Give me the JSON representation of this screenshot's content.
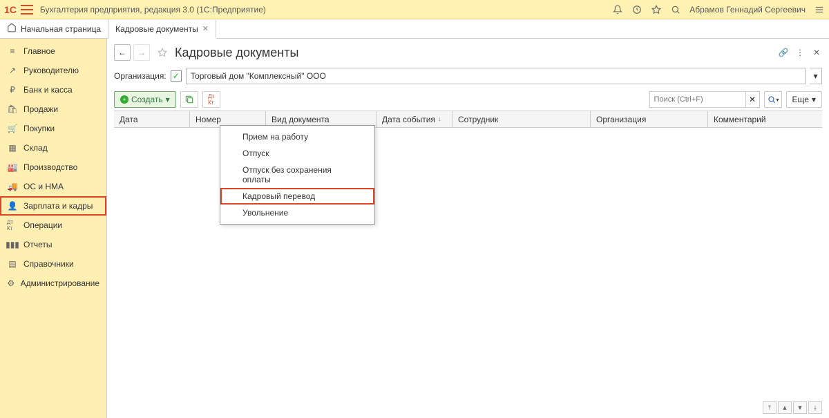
{
  "top": {
    "title": "Бухгалтерия предприятия, редакция 3.0  (1С:Предприятие)",
    "user": "Абрамов Геннадий Сергеевич"
  },
  "tabs": {
    "home": "Начальная страница",
    "active": "Кадровые документы"
  },
  "sidebar": {
    "items": [
      "Главное",
      "Руководителю",
      "Банк и касса",
      "Продажи",
      "Покупки",
      "Склад",
      "Производство",
      "ОС и НМА",
      "Зарплата и кадры",
      "Операции",
      "Отчеты",
      "Справочники",
      "Администрирование"
    ]
  },
  "page": {
    "title": "Кадровые документы",
    "filter_label": "Организация:",
    "org_value": "Торговый дом \"Комплексный\" ООО",
    "create_label": "Создать",
    "search_placeholder": "Поиск (Ctrl+F)",
    "more_label": "Еще"
  },
  "columns": {
    "c0": "Дата",
    "c1": "Номер",
    "c2": "Вид документа",
    "c3": "Дата события",
    "c4": "Сотрудник",
    "c5": "Организация",
    "c6": "Комментарий"
  },
  "menu": {
    "items": [
      "Прием на работу",
      "Отпуск",
      "Отпуск без сохранения оплаты",
      "Кадровый перевод",
      "Увольнение"
    ]
  }
}
